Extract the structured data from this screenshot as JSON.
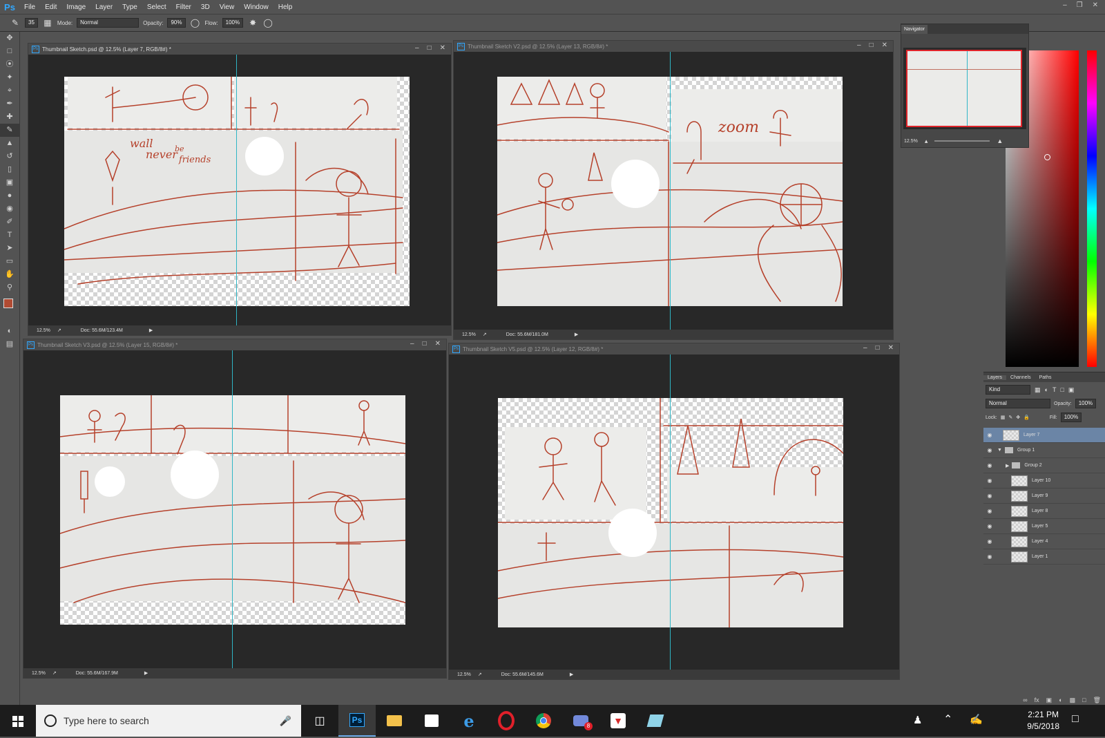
{
  "app": {
    "name": "Ps"
  },
  "menu": [
    "File",
    "Edit",
    "Image",
    "Layer",
    "Type",
    "Select",
    "Filter",
    "3D",
    "View",
    "Window",
    "Help"
  ],
  "options": {
    "brush_size": "35",
    "mode_label": "Mode:",
    "mode_value": "Normal",
    "opacity_label": "Opacity:",
    "opacity_value": "90%",
    "flow_label": "Flow:",
    "flow_value": "100%"
  },
  "documents": [
    {
      "title": "Thumbnail Sketch.psd @ 12.5% (Layer 7, RGB/8#) *",
      "zoom": "12.5%",
      "doc": "Doc: 55.6M/123.4M",
      "active": true
    },
    {
      "title": "Thumbnail Sketch V2.psd @ 12.5% (Layer 13, RGB/8#) *",
      "zoom": "12.5%",
      "doc": "Doc: 55.6M/181.0M",
      "active": false
    },
    {
      "title": "Thumbnail Sketch V3.psd @ 12.5% (Layer 15, RGB/8#) *",
      "zoom": "12.5%",
      "doc": "Doc: 55.6M/167.9M",
      "active": false
    },
    {
      "title": "Thumbnail Sketch V5.psd @ 12.5% (Layer 12, RGB/8#) *",
      "zoom": "12.5%",
      "doc": "Doc: 55.6M/145.6M",
      "active": false
    }
  ],
  "sketch_text": {
    "doc1": [
      "wall",
      "never",
      "be",
      "friends"
    ],
    "doc2": "zoom"
  },
  "navigator": {
    "title": "Navigator",
    "zoom": "12.5%"
  },
  "layers_panel": {
    "tabs": [
      "Layers",
      "Channels",
      "Paths"
    ],
    "kind": "Kind",
    "blend": "Normal",
    "opacity_label": "Opacity:",
    "opacity_value": "100%",
    "lock_label": "Lock:",
    "fill_label": "Fill:",
    "fill_value": "100%",
    "layers": [
      {
        "name": "Layer 7",
        "type": "layer",
        "selected": true
      },
      {
        "name": "Group 1",
        "type": "group-open"
      },
      {
        "name": "Group 2",
        "type": "group-closed"
      },
      {
        "name": "Layer 10",
        "type": "layer"
      },
      {
        "name": "Layer 9",
        "type": "layer"
      },
      {
        "name": "Layer 8",
        "type": "layer"
      },
      {
        "name": "Layer 5",
        "type": "layer"
      },
      {
        "name": "Layer 4",
        "type": "layer"
      },
      {
        "name": "Layer 1",
        "type": "layer"
      }
    ]
  },
  "taskbar": {
    "search_placeholder": "Type here to search",
    "time": "2:21 PM",
    "date": "9/5/2018",
    "badge": "8",
    "apps": [
      "task-view",
      "photoshop",
      "file-explorer",
      "store",
      "edge",
      "opera",
      "chrome",
      "discord",
      "antivirus",
      "notes"
    ]
  },
  "colors": {
    "accent": "#31a8ff",
    "sketch": "#b5402a",
    "guide": "#2fb6c6",
    "foreground": "#b04b33"
  }
}
